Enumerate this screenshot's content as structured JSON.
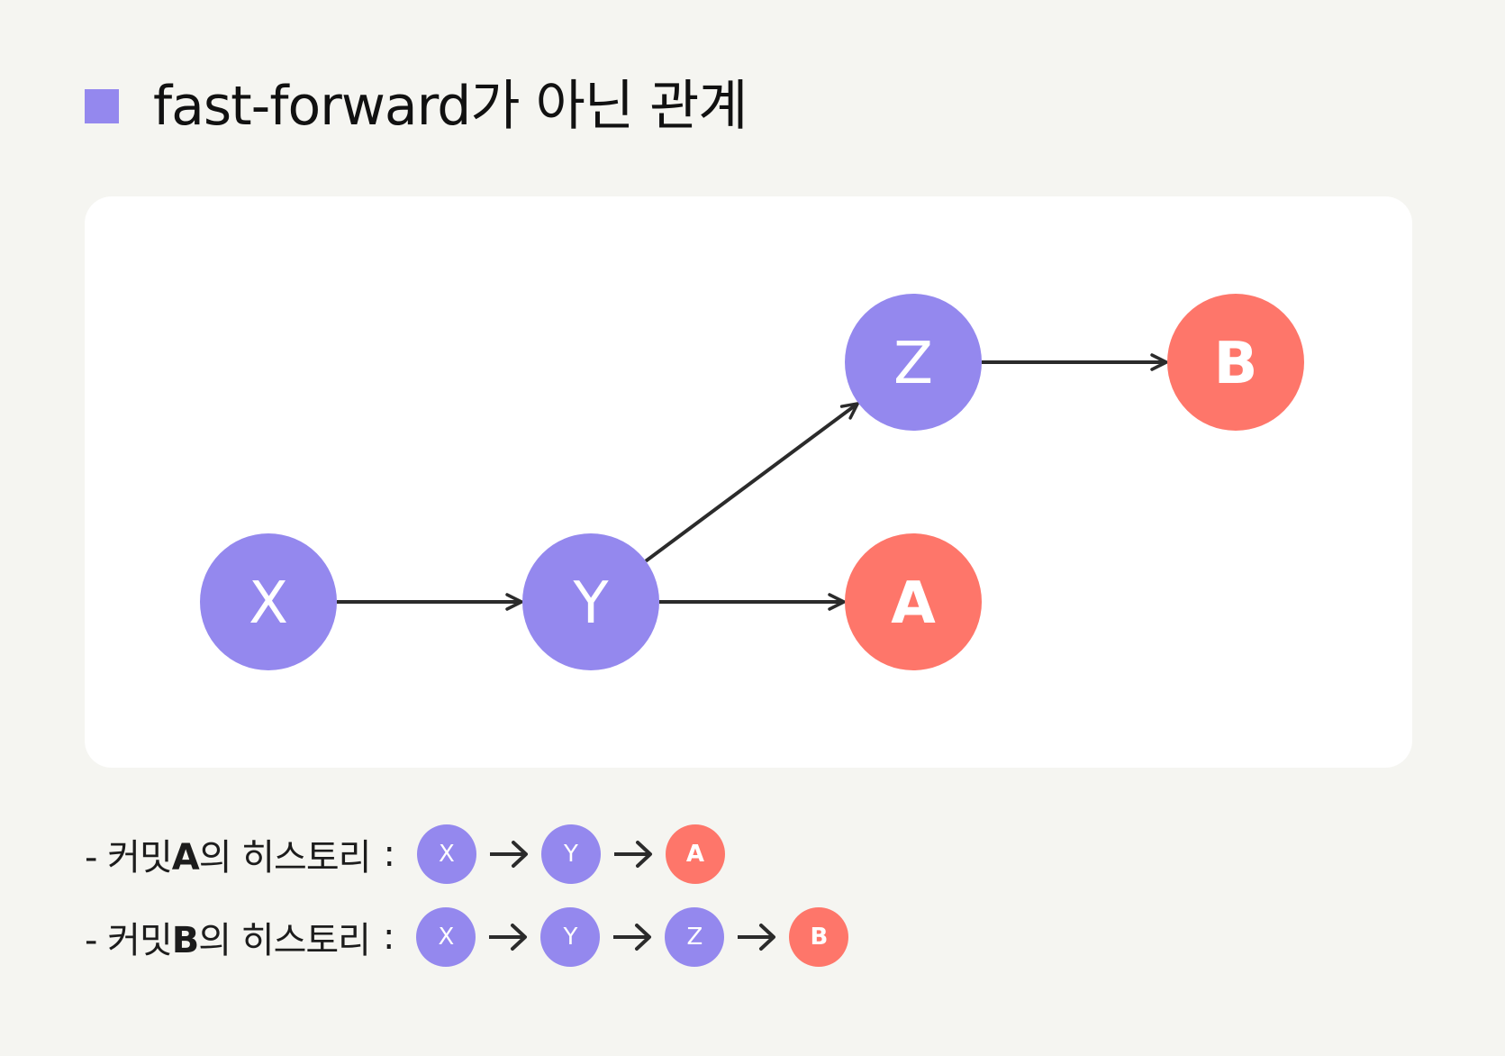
{
  "title": "fast-forward가 아닌 관계",
  "colors": {
    "purple": "#9488ee",
    "red": "#fe766a",
    "line": "#2b2b2b"
  },
  "graph": {
    "nodes": [
      {
        "id": "X",
        "label": "X",
        "color": "purple"
      },
      {
        "id": "Y",
        "label": "Y",
        "color": "purple"
      },
      {
        "id": "Z",
        "label": "Z",
        "color": "purple"
      },
      {
        "id": "A",
        "label": "A",
        "color": "red"
      },
      {
        "id": "B",
        "label": "B",
        "color": "red"
      }
    ],
    "edges": [
      {
        "from": "X",
        "to": "Y"
      },
      {
        "from": "Y",
        "to": "A"
      },
      {
        "from": "Y",
        "to": "Z"
      },
      {
        "from": "Z",
        "to": "B"
      }
    ]
  },
  "histories": [
    {
      "prefix": "- 커밋",
      "commit": "A",
      "suffix": "의 히스토리",
      "colon": ":",
      "chain": [
        {
          "label": "X",
          "color": "purple"
        },
        {
          "label": "Y",
          "color": "purple"
        },
        {
          "label": "A",
          "color": "red"
        }
      ]
    },
    {
      "prefix": "- 커밋",
      "commit": "B",
      "suffix": "의 히스토리",
      "colon": ":",
      "chain": [
        {
          "label": "X",
          "color": "purple"
        },
        {
          "label": "Y",
          "color": "purple"
        },
        {
          "label": "Z",
          "color": "purple"
        },
        {
          "label": "B",
          "color": "red"
        }
      ]
    }
  ]
}
